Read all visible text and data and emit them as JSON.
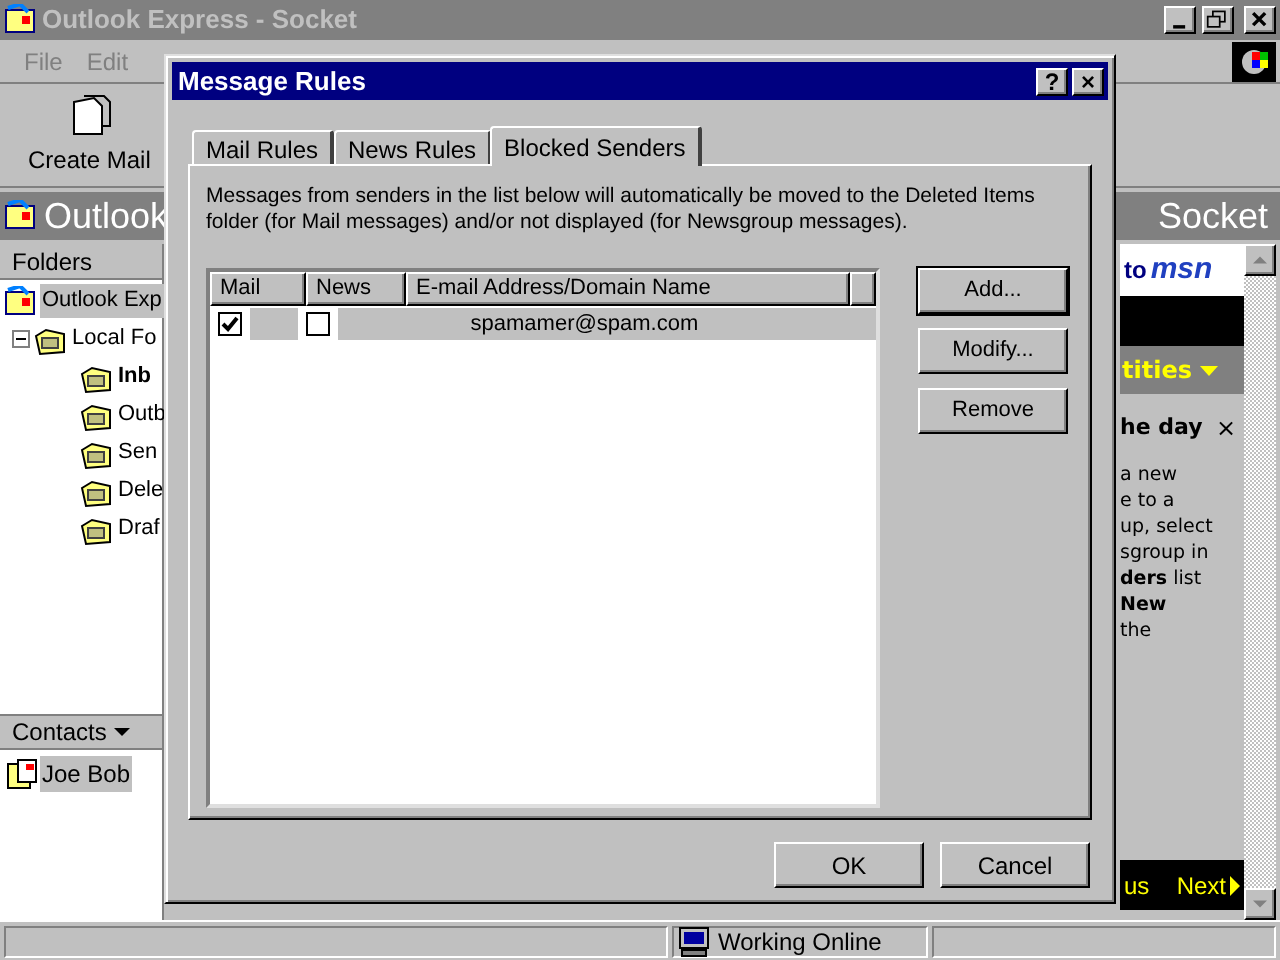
{
  "window": {
    "title": "Outlook Express - Socket"
  },
  "menu": [
    {
      "label": "File"
    },
    {
      "label": "Edit"
    }
  ],
  "toolbar": [
    {
      "label": "Create Mail"
    }
  ],
  "header": {
    "title": "Outlook",
    "identity": "Socket"
  },
  "folders": {
    "title": "Folders",
    "tree": [
      {
        "label": "Outlook Exp",
        "selected": true,
        "unread": false,
        "children": [
          {
            "label": "Local Fo",
            "selected": false,
            "unread": false,
            "expanded": true,
            "children": [
              {
                "label": "Inb",
                "selected": false,
                "unread": true
              },
              {
                "label": "Outb",
                "selected": false,
                "unread": false
              },
              {
                "label": "Sen",
                "selected": false,
                "unread": false
              },
              {
                "label": "Dele",
                "selected": false,
                "unread": false
              },
              {
                "label": "Draf",
                "selected": false,
                "unread": false
              }
            ]
          }
        ]
      }
    ]
  },
  "contacts": {
    "title": "Contacts",
    "items": [
      {
        "name": "Joe Bob",
        "selected": true
      }
    ]
  },
  "msn_pane": {
    "banner": "to",
    "logo": "msn",
    "section": "tities",
    "tip_title": "he day",
    "tip_close": "×",
    "tip_lines": [
      "a new",
      "e to a",
      "up, select",
      "sgroup in",
      "**ders** list",
      "**New**",
      "the"
    ],
    "prev": "us",
    "next": "Next"
  },
  "status_bar": {
    "text": "Working Online"
  },
  "dialog": {
    "title": "Message Rules",
    "title_buttons": [
      "?",
      "×"
    ],
    "tabs": [
      {
        "label": "Mail Rules",
        "selected": false
      },
      {
        "label": "News Rules",
        "selected": false
      },
      {
        "label": "Blocked Senders",
        "selected": true
      }
    ],
    "description": "Messages from senders in the list below will automatically be moved to the Deleted Items folder (for Mail messages) and/or not displayed (for Newsgroup messages).",
    "list": {
      "columns": [
        "Mail",
        "News",
        "E-mail Address/Domain Name"
      ],
      "rows": [
        {
          "mail": true,
          "news": false,
          "address": "spamamer@spam.com",
          "selected": true
        }
      ]
    },
    "side_buttons": [
      {
        "label": "Add...",
        "default": true
      },
      {
        "label": "Modify...",
        "default": false
      },
      {
        "label": "Remove",
        "default": false
      }
    ],
    "footer_buttons": [
      {
        "label": "OK"
      },
      {
        "label": "Cancel"
      }
    ]
  }
}
